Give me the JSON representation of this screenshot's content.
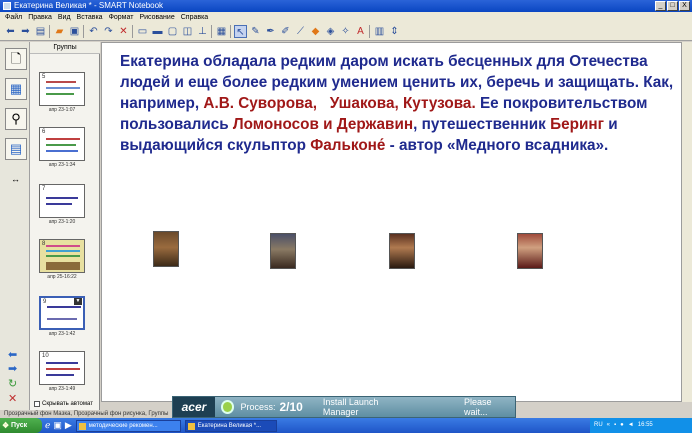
{
  "window": {
    "title": "Екатерина Великая * - SMART Notebook",
    "controls": [
      "_",
      "□",
      "X"
    ]
  },
  "menu": [
    "Файл",
    "Правка",
    "Вид",
    "Вставка",
    "Формат",
    "Рисование",
    "Справка"
  ],
  "toolbar_icons": [
    "back-arrow-icon",
    "forward-arrow-icon",
    "add-page-icon",
    "sep",
    "open-icon",
    "save-icon",
    "sep",
    "undo-icon",
    "redo-icon",
    "delete-icon",
    "sep",
    "screen-shade-icon",
    "projector-icon",
    "capture-icon",
    "dual-page-icon",
    "document-camera-icon",
    "sep",
    "table-icon",
    "sep",
    "select-icon",
    "pen-icon",
    "creative-pen-icon",
    "eraser-icon",
    "line-icon",
    "shape-icon",
    "fill-icon",
    "magic-pen-icon",
    "text-icon",
    "sep",
    "properties-icon",
    "more-icon"
  ],
  "sorter": {
    "header": "Группы",
    "thumbnails": [
      {
        "num": "5",
        "label": "апр 23-1:07"
      },
      {
        "num": "6",
        "label": "апр 23-1:34"
      },
      {
        "num": "7",
        "label": "апр 23-1:20"
      },
      {
        "num": "8",
        "label": "апр 25-16:22"
      },
      {
        "num": "9",
        "label": "апр 23-1:42"
      },
      {
        "num": "10",
        "label": "апр 23-1:49"
      }
    ],
    "autohide_label": "Скрывать автомат"
  },
  "canvas": {
    "text": {
      "p1": "Екатерина обладала редким даром искать бесценных для Отечества людей и еще более редким умением ценить их, беречь и защищать. Как, например, ",
      "suvorov": "А.В. Суворова,",
      "ushakov": "Ушакова,",
      "kutuzov": "Кутузова.",
      "p2": " Ее покровительством пользовались ",
      "lomonosov": "Ломоносов и Державин",
      "p3": ", путешественник ",
      "bering": "Беринг",
      "p4": " и выдающийся скульптор ",
      "falcone": "Фальконе́",
      "p5": " - автор «Медного всадника»."
    }
  },
  "acer": {
    "logo": "acer",
    "process_label": "Process:",
    "count": "2/10",
    "install": "Install Launch Manager",
    "wait": "Please wait..."
  },
  "statusbar": "Прозрачный фон Мазка, Прозрачный фон рисунка, Группы",
  "taskbar": {
    "start": "Пуск",
    "tasks": [
      "методические рекомен...",
      "Екатерина Великая *..."
    ],
    "tray": {
      "lang": "RU",
      "time": "16:55"
    }
  }
}
